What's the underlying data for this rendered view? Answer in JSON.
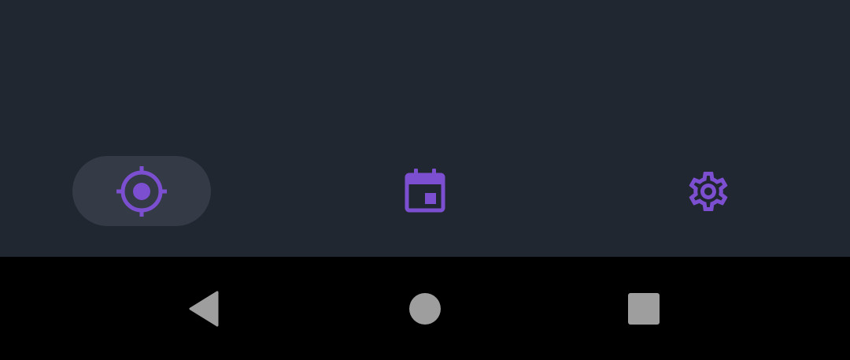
{
  "colors": {
    "background": "#212731",
    "accent": "#7b4fcf",
    "active_pill": "#343b46",
    "system_bar": "#000000",
    "system_icons": "#9e9e9e"
  },
  "bottom_nav": {
    "selected_index": 0,
    "items": [
      {
        "icon": "my-location-icon"
      },
      {
        "icon": "calendar-icon"
      },
      {
        "icon": "gear-icon"
      }
    ]
  },
  "system_nav": {
    "buttons": [
      {
        "icon": "back-triangle-icon"
      },
      {
        "icon": "home-circle-icon"
      },
      {
        "icon": "recents-square-icon"
      }
    ]
  }
}
